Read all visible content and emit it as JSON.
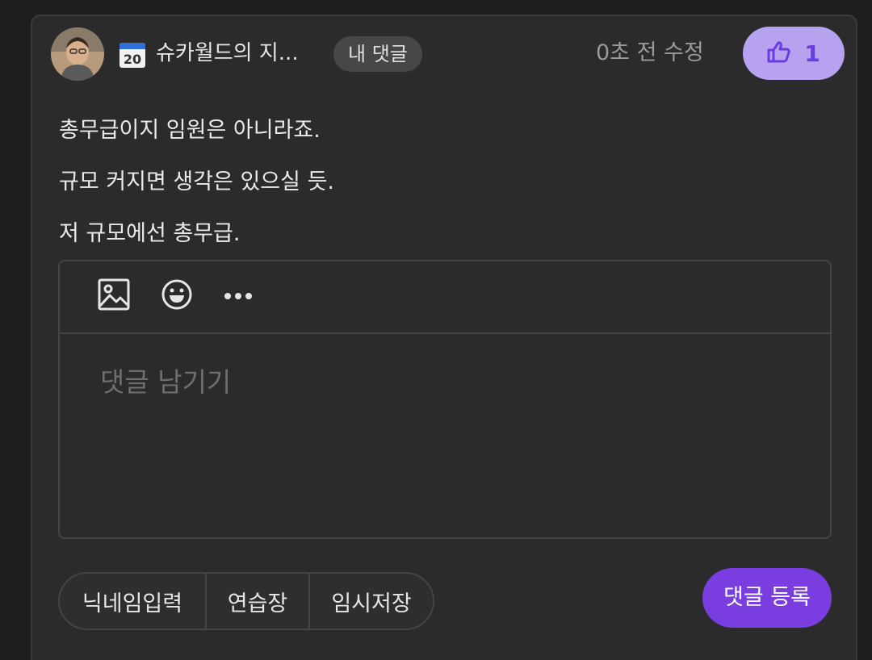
{
  "comment": {
    "author_nickname": "슈카월드의 지...",
    "calendar_icon_text": "20",
    "my_comment_badge": "내 댓글",
    "timestamp": "0초 전 수정",
    "like_count": "1",
    "lines": [
      "총무급이지 임원은 아니라죠.",
      "규모 커지면 생각은 있으실 듯.",
      "저 규모에선 총무급."
    ]
  },
  "reply": {
    "toolbar_icons": [
      "image-icon",
      "emoji-icon",
      "more-icon"
    ],
    "placeholder": "댓글 남기기"
  },
  "actions": {
    "nickname_input": "닉네임입력",
    "practice": "연습장",
    "temp_save": "임시저장",
    "submit": "댓글 등록"
  },
  "colors": {
    "background": "#1e1e1e",
    "card": "#2b2b2b",
    "like_bg": "#b6a2ee",
    "like_fg": "#6a3de0",
    "submit_bg": "#7a3de0"
  }
}
